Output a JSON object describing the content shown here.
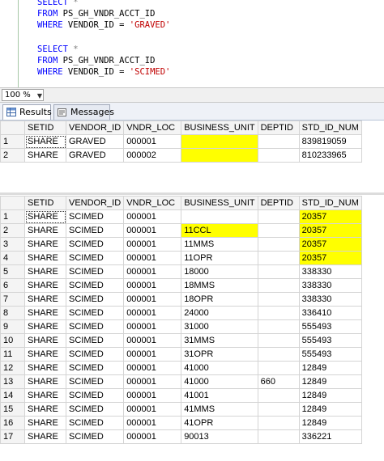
{
  "editor": {
    "query1": {
      "select": "SELECT",
      "select_star": " *",
      "from_kw": "FROM",
      "from_table": " PS_GH_VNDR_ACCT_ID",
      "where_kw": "WHERE",
      "where_cond": " VENDOR_ID = ",
      "where_value": "'GRAVED'"
    },
    "query2": {
      "select": "SELECT",
      "select_star": " *",
      "from_kw": "FROM",
      "from_table": " PS_GH_VNDR_ACCT_ID",
      "where_kw": "WHERE",
      "where_cond": " VENDOR_ID = ",
      "where_value": "'SCIMED'"
    }
  },
  "zoom": {
    "value": "100 %"
  },
  "tabs": [
    {
      "label": "Results",
      "icon": "grid-icon"
    },
    {
      "label": "Messages",
      "icon": "messages-icon"
    }
  ],
  "colors": {
    "highlight": "#ffff00"
  },
  "columns": [
    "",
    "SETID",
    "VENDOR_ID",
    "VNDR_LOC",
    "BUSINESS_UNIT",
    "DEPTID",
    "STD_ID_NUM"
  ],
  "result1": [
    {
      "rn": "1",
      "setid": "SHARE",
      "vendor": "GRAVED",
      "loc": "000001",
      "bu": "",
      "dept": "",
      "std": "839819059"
    },
    {
      "rn": "2",
      "setid": "SHARE",
      "vendor": "GRAVED",
      "loc": "000002",
      "bu": "",
      "dept": "",
      "std": "810233965"
    }
  ],
  "result2": [
    {
      "rn": "1",
      "setid": "SHARE",
      "vendor": "SCIMED",
      "loc": "000001",
      "bu": "",
      "dept": "",
      "std": "20357"
    },
    {
      "rn": "2",
      "setid": "SHARE",
      "vendor": "SCIMED",
      "loc": "000001",
      "bu": "11CCL",
      "dept": "",
      "std": "20357"
    },
    {
      "rn": "3",
      "setid": "SHARE",
      "vendor": "SCIMED",
      "loc": "000001",
      "bu": "11MMS",
      "dept": "",
      "std": "20357"
    },
    {
      "rn": "4",
      "setid": "SHARE",
      "vendor": "SCIMED",
      "loc": "000001",
      "bu": "11OPR",
      "dept": "",
      "std": "20357"
    },
    {
      "rn": "5",
      "setid": "SHARE",
      "vendor": "SCIMED",
      "loc": "000001",
      "bu": "18000",
      "dept": "",
      "std": "338330"
    },
    {
      "rn": "6",
      "setid": "SHARE",
      "vendor": "SCIMED",
      "loc": "000001",
      "bu": "18MMS",
      "dept": "",
      "std": "338330"
    },
    {
      "rn": "7",
      "setid": "SHARE",
      "vendor": "SCIMED",
      "loc": "000001",
      "bu": "18OPR",
      "dept": "",
      "std": "338330"
    },
    {
      "rn": "8",
      "setid": "SHARE",
      "vendor": "SCIMED",
      "loc": "000001",
      "bu": "24000",
      "dept": "",
      "std": "336410"
    },
    {
      "rn": "9",
      "setid": "SHARE",
      "vendor": "SCIMED",
      "loc": "000001",
      "bu": "31000",
      "dept": "",
      "std": "555493"
    },
    {
      "rn": "10",
      "setid": "SHARE",
      "vendor": "SCIMED",
      "loc": "000001",
      "bu": "31MMS",
      "dept": "",
      "std": "555493"
    },
    {
      "rn": "11",
      "setid": "SHARE",
      "vendor": "SCIMED",
      "loc": "000001",
      "bu": "31OPR",
      "dept": "",
      "std": "555493"
    },
    {
      "rn": "12",
      "setid": "SHARE",
      "vendor": "SCIMED",
      "loc": "000001",
      "bu": "41000",
      "dept": "",
      "std": "12849"
    },
    {
      "rn": "13",
      "setid": "SHARE",
      "vendor": "SCIMED",
      "loc": "000001",
      "bu": "41000",
      "dept": "660",
      "std": "12849"
    },
    {
      "rn": "14",
      "setid": "SHARE",
      "vendor": "SCIMED",
      "loc": "000001",
      "bu": "41001",
      "dept": "",
      "std": "12849"
    },
    {
      "rn": "15",
      "setid": "SHARE",
      "vendor": "SCIMED",
      "loc": "000001",
      "bu": "41MMS",
      "dept": "",
      "std": "12849"
    },
    {
      "rn": "16",
      "setid": "SHARE",
      "vendor": "SCIMED",
      "loc": "000001",
      "bu": "41OPR",
      "dept": "",
      "std": "12849"
    },
    {
      "rn": "17",
      "setid": "SHARE",
      "vendor": "SCIMED",
      "loc": "000001",
      "bu": "90013",
      "dept": "",
      "std": "336221"
    }
  ]
}
